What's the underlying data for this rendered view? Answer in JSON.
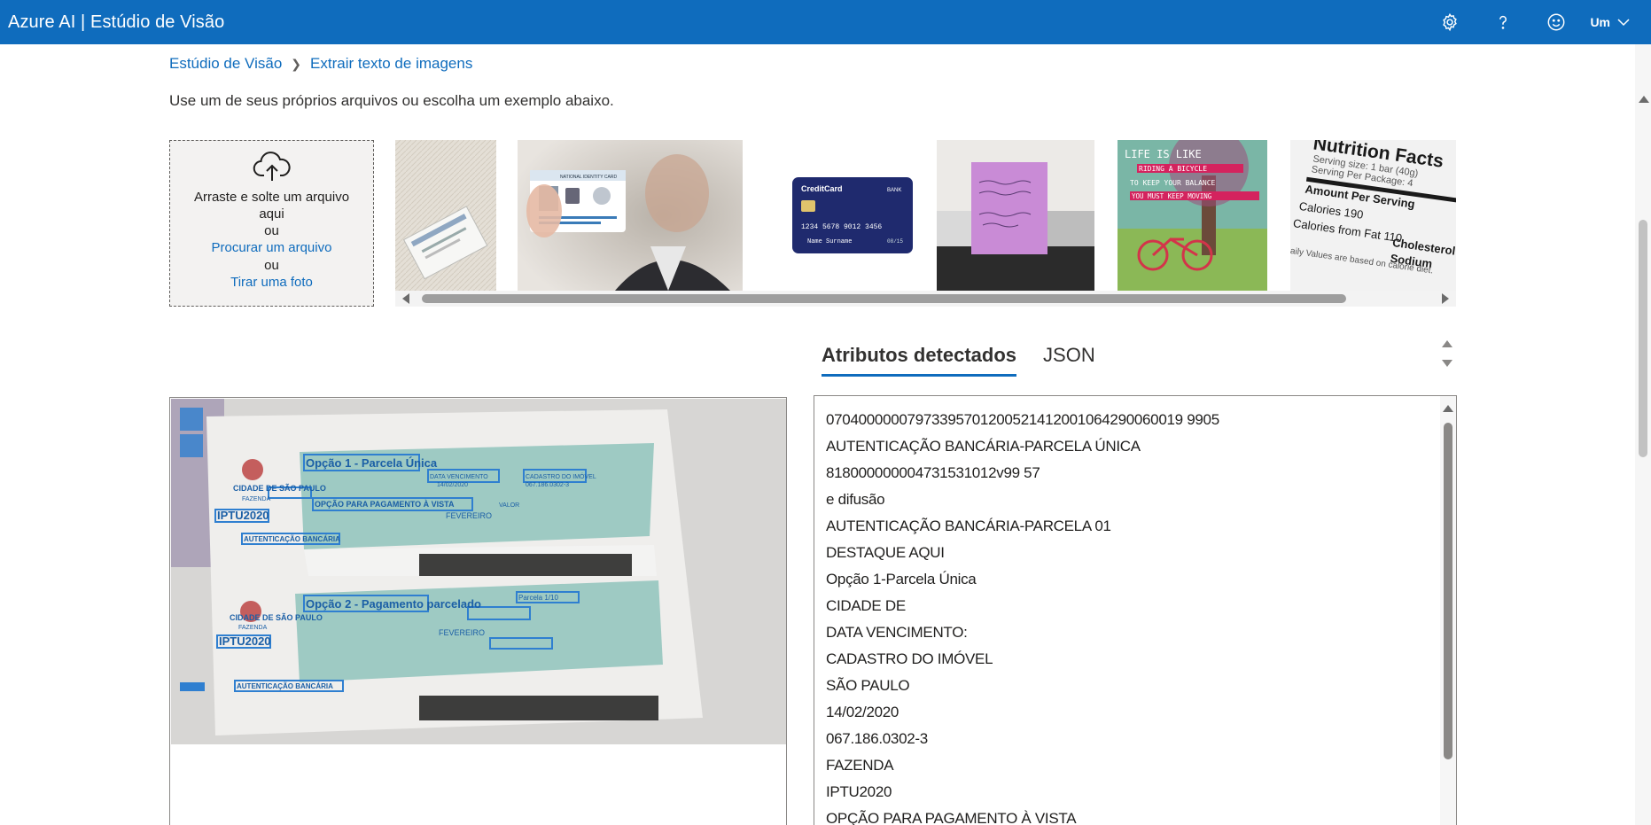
{
  "app": {
    "title": "Azure AI | Estúdio de Visão"
  },
  "header": {
    "icons": [
      "settings-icon",
      "help-icon",
      "feedback-icon"
    ],
    "user_label": "Um"
  },
  "breadcrumb": {
    "root": "Estúdio de Visão",
    "current": "Extrair texto de imagens"
  },
  "instructions": "Use um de seus próprios arquivos ou escolha um exemplo abaixo.",
  "upload": {
    "drag_text": "Arraste e solte um arquivo aqui",
    "or1": "ou",
    "browse_link": "Procurar um arquivo",
    "or2": "ou",
    "photo_link": "Tirar uma foto"
  },
  "samples": {
    "credit_card": {
      "brand": "CreditCard",
      "bank": "BANK",
      "number": "1234 5678 9012 3456",
      "name": "Name Surname",
      "exp": "08/15"
    },
    "id_card": {
      "header": "NATIONAL IDENTITY CARD"
    },
    "poster": {
      "lines": [
        "LIFE IS LIKE",
        "RIDING A BICYCLE",
        "TO KEEP YOUR BALANCE",
        "YOU MUST KEEP MOVING"
      ]
    },
    "nutrition": {
      "title": "Nutrition Facts",
      "lines": [
        "Serving size: 1 bar (40g)",
        "Serving Per Package: 4",
        "Amount Per Serving",
        "Calories 190",
        "Calories from Fat 110",
        "Cholesterol",
        "Sodium",
        "Daily Values are based on calorie diet."
      ]
    }
  },
  "result_image": {
    "top_form": {
      "title": "Opção 1 - Parcela Única",
      "city": "CIDADE DE SÃO PAULO",
      "dept": "FAZENDA",
      "tax": "IPTU2020",
      "label1": "DATA VENCIMENTO",
      "date": "14/02/2020",
      "label2": "CADASTRO DO IMÓVEL",
      "cadastro": "067.186.0302-3",
      "option": "OPÇÃO PARA PAGAMENTO À VISTA",
      "month": "FEVEREIRO",
      "valor": "VALOR",
      "auth": "AUTENTICAÇÃO BANCÁRIA"
    },
    "bottom_form": {
      "title": "Opção 2 - Pagamento parcelado",
      "parcela": "Parcela 1/10",
      "city": "CIDADE DE SÃO PAULO",
      "dept": "FAZENDA",
      "tax": "IPTU2020",
      "month": "FEVEREIRO",
      "auth": "AUTENTICAÇÃO BANCÁRIA"
    }
  },
  "tabs": [
    {
      "label": "Atributos detectados",
      "active": true
    },
    {
      "label": "JSON",
      "active": false
    }
  ],
  "detected_text": [
    "07040000007973395701200521412001064290060019 9905",
    "AUTENTICAÇÃO BANCÁRIA-PARCELA   ÚNICA",
    "818000000004731531012v99 57",
    "e difusão",
    "AUTENTICAÇÃO BANCÁRIA-PARCELA   01",
    "DESTAQUE AQUI",
    "Opção  1-Parcela  Única",
    "CIDADE DE",
    "DATA VENCIMENTO:",
    "CADASTRO DO IMÓVEL",
    "SÃO PAULO",
    "14/02/2020",
    "067.186.0302-3",
    "FAZENDA",
    "IPTU2020",
    "OPÇÃO PARA PAGAMENTO À VISTA"
  ],
  "colors": {
    "accent": "#0f6cbd",
    "box": "#2f7fd0"
  }
}
